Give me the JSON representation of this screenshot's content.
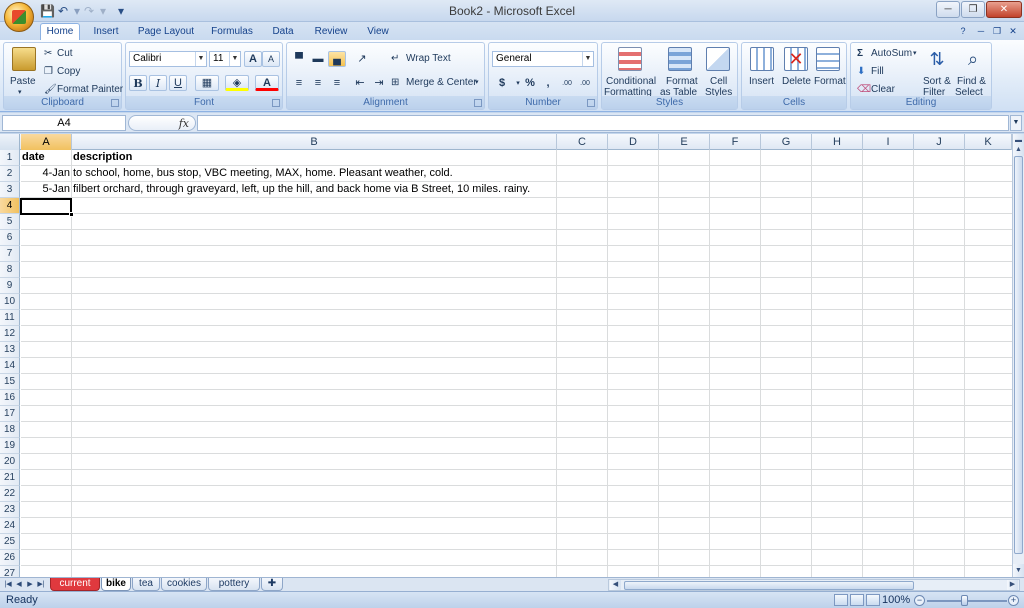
{
  "window": {
    "title": "Book2 - Microsoft Excel"
  },
  "ribbon_tabs": [
    "Home",
    "Insert",
    "Page Layout",
    "Formulas",
    "Data",
    "Review",
    "View"
  ],
  "clipboard": {
    "paste": "Paste",
    "cut": "Cut",
    "copy": "Copy",
    "format_painter": "Format Painter",
    "label": "Clipboard"
  },
  "font": {
    "name": "Calibri",
    "size": "11",
    "bold": "B",
    "italic": "I",
    "underline": "U",
    "font_color": "A",
    "grow": "A",
    "shrink": "A",
    "label": "Font"
  },
  "alignment": {
    "wrap_text": "Wrap Text",
    "merge_center": "Merge & Center",
    "label": "Alignment"
  },
  "number": {
    "format": "General",
    "currency": "$",
    "percent": "%",
    "comma": ",",
    "inc_decimal": ".00",
    "dec_decimal": ".00",
    "label": "Number"
  },
  "styles": {
    "conditional_1": "Conditional",
    "conditional_2": "Formatting",
    "format_table_1": "Format",
    "format_table_2": "as Table",
    "cell_styles_1": "Cell",
    "cell_styles_2": "Styles",
    "label": "Styles"
  },
  "cells": {
    "insert": "Insert",
    "delete": "Delete",
    "format": "Format",
    "label": "Cells"
  },
  "editing": {
    "autosum": "AutoSum",
    "fill": "Fill",
    "clear": "Clear",
    "sort_1": "Sort &",
    "sort_2": "Filter",
    "find_1": "Find &",
    "find_2": "Select",
    "label": "Editing"
  },
  "formula_bar": {
    "name_box": "A4",
    "fx": "fx",
    "value": ""
  },
  "columns": [
    "A",
    "B",
    "C",
    "D",
    "E",
    "F",
    "G",
    "H",
    "I",
    "J",
    "K"
  ],
  "rows": [
    "1",
    "2",
    "3",
    "4",
    "5",
    "6",
    "7",
    "8",
    "9",
    "10",
    "11",
    "12",
    "13",
    "14",
    "15",
    "16",
    "17",
    "18",
    "19",
    "20",
    "21",
    "22",
    "23",
    "24",
    "25",
    "26",
    "27"
  ],
  "cells_data": {
    "a1": "date",
    "b1": "description",
    "a2": "4-Jan",
    "b2": "to school, home, bus stop, VBC meeting, MAX, home. Pleasant weather, cold.",
    "a3": "5-Jan",
    "b3": "filbert orchard, through graveyard, left, up the hill, and back home via B Street, 10 miles. rainy."
  },
  "sheet_tabs": [
    "current",
    "bike",
    "tea",
    "cookies",
    "pottery"
  ],
  "active_sheet": "bike",
  "status": {
    "text": "Ready",
    "zoom": "100%"
  },
  "colors": {
    "current_tab": "#e0393e",
    "selection_header": "#f1c15f",
    "ribbon_border": "#8db2e3"
  }
}
